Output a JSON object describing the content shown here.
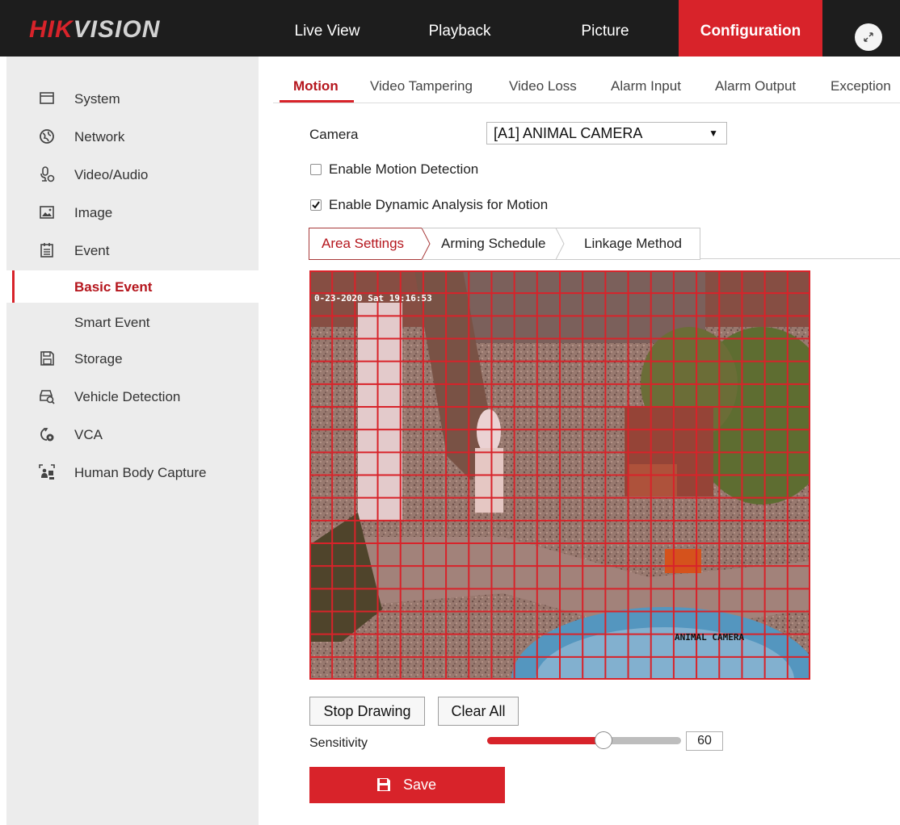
{
  "brand": {
    "part1": "HIK",
    "part2": "VISION"
  },
  "topnav": {
    "items": [
      {
        "label": "Live View"
      },
      {
        "label": "Playback"
      },
      {
        "label": "Picture"
      },
      {
        "label": "Configuration",
        "active": true
      }
    ],
    "expand_icon": "expand-icon"
  },
  "sidebar": {
    "items": [
      {
        "label": "System",
        "icon": "monitor-icon"
      },
      {
        "label": "Network",
        "icon": "globe-icon"
      },
      {
        "label": "Video/Audio",
        "icon": "microphone-icon"
      },
      {
        "label": "Image",
        "icon": "image-icon"
      },
      {
        "label": "Event",
        "icon": "calendar-icon"
      },
      {
        "label": "Basic Event",
        "active": true
      },
      {
        "label": "Smart Event"
      },
      {
        "label": "Storage",
        "icon": "floppy-icon"
      },
      {
        "label": "Vehicle Detection",
        "icon": "vehicle-search-icon"
      },
      {
        "label": "VCA",
        "icon": "vca-icon"
      },
      {
        "label": "Human Body Capture",
        "icon": "human-capture-icon"
      }
    ]
  },
  "tabs": [
    {
      "label": "Motion",
      "active": true
    },
    {
      "label": "Video Tampering"
    },
    {
      "label": "Video Loss"
    },
    {
      "label": "Alarm Input"
    },
    {
      "label": "Alarm Output"
    },
    {
      "label": "Exception"
    }
  ],
  "form": {
    "camera_label": "Camera",
    "camera_value": "[A1] ANIMAL CAMERA",
    "enable_motion_label": "Enable Motion Detection",
    "enable_motion_checked": false,
    "enable_dynamic_label": "Enable Dynamic Analysis for Motion",
    "enable_dynamic_checked": true
  },
  "subtabs": [
    {
      "label": "Area Settings",
      "active": true
    },
    {
      "label": "Arming Schedule"
    },
    {
      "label": "Linkage Method"
    }
  ],
  "video": {
    "osd_timestamp": "0-23-2020 Sat 19:16:53",
    "osd_camera_name": "ANIMAL CAMERA",
    "grid_color": "#d8232a"
  },
  "controls": {
    "stop_drawing": "Stop Drawing",
    "clear_all": "Clear All",
    "sensitivity_label": "Sensitivity",
    "sensitivity_value": "60",
    "sensitivity_fraction": 0.6,
    "save_label": "Save"
  },
  "colors": {
    "accent": "#d8232a",
    "topbar": "#1d1d1d",
    "sidebar": "#ececec"
  }
}
